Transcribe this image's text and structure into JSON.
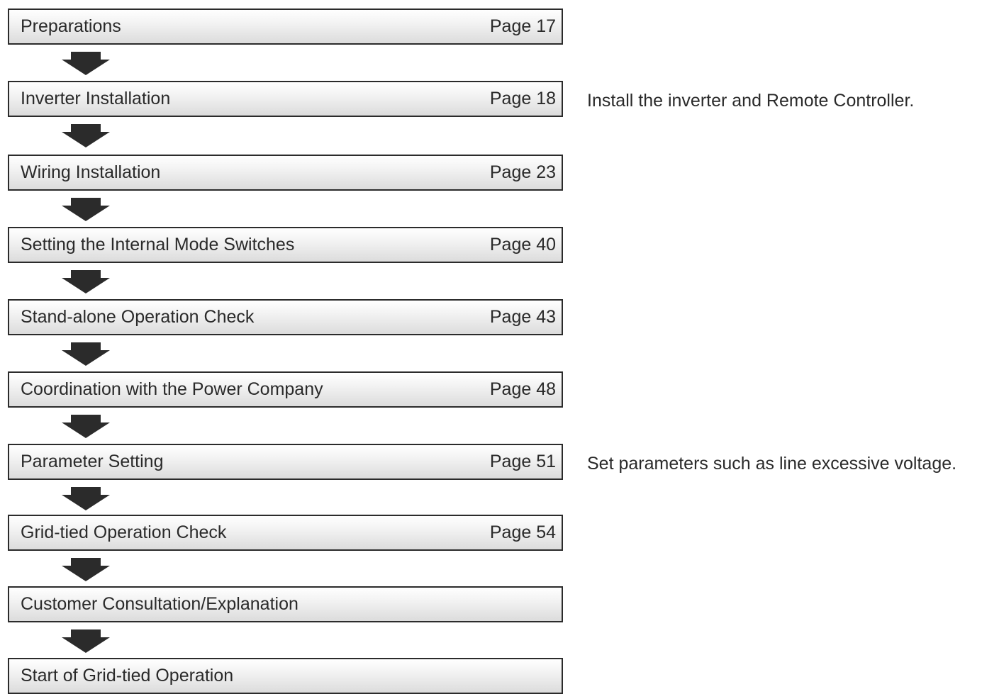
{
  "steps": [
    {
      "label": "Preparations",
      "page": "Page 17",
      "note": ""
    },
    {
      "label": "Inverter Installation",
      "page": "Page 18",
      "note": "Install the inverter and Remote Controller."
    },
    {
      "label": "Wiring Installation",
      "page": "Page 23",
      "note": ""
    },
    {
      "label": "Setting the Internal Mode Switches",
      "page": "Page 40",
      "note": ""
    },
    {
      "label": "Stand-alone Operation Check",
      "page": "Page 43",
      "note": ""
    },
    {
      "label": "Coordination with the Power Company",
      "page": "Page 48",
      "note": ""
    },
    {
      "label": "Parameter Setting",
      "page": "Page 51",
      "note": "Set parameters such as line excessive voltage."
    },
    {
      "label": "Grid-tied Operation Check",
      "page": "Page 54",
      "note": ""
    },
    {
      "label": "Customer Consultation/Explanation",
      "page": "",
      "note": ""
    },
    {
      "label": "Start of Grid-tied Operation",
      "page": "",
      "note": ""
    }
  ],
  "colors": {
    "arrow": "#2b2b2b",
    "border": "#2b2b2b",
    "text": "#2a2a2a"
  },
  "icons": {
    "arrow": "down-arrow-icon"
  }
}
